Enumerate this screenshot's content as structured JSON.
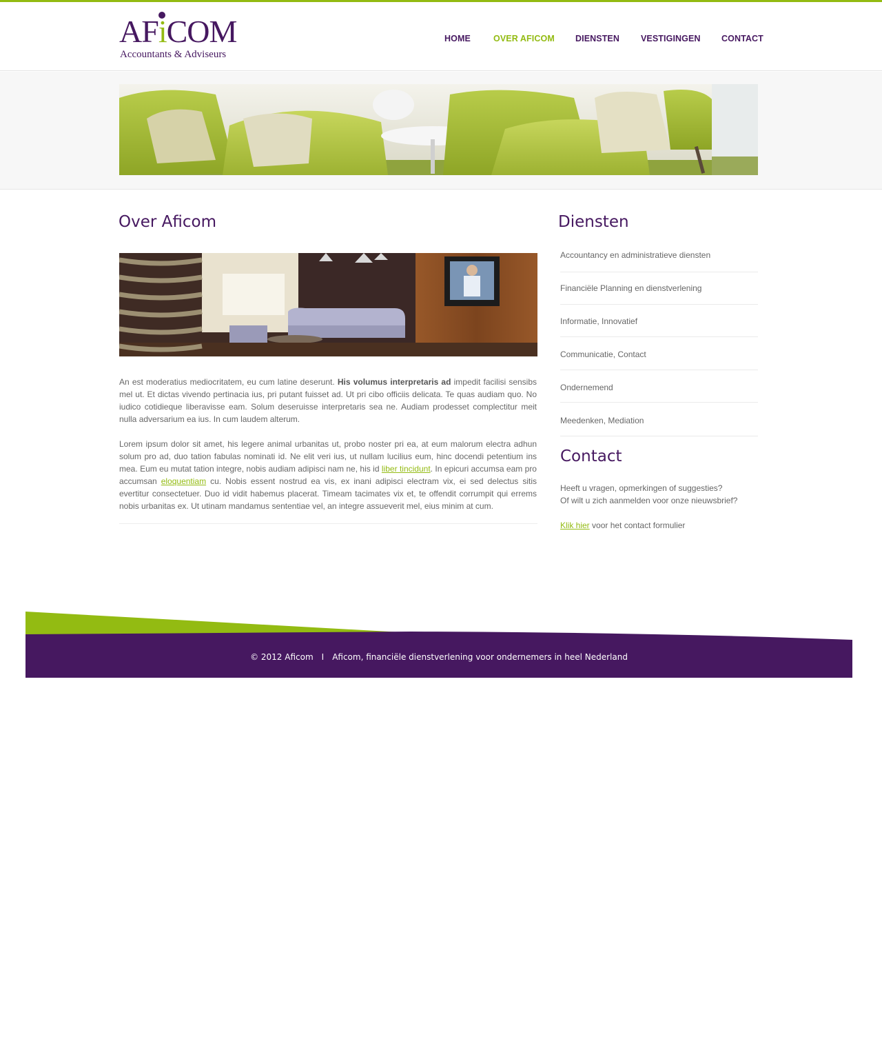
{
  "brand": {
    "logo_word_a": "AF",
    "logo_word_i": "i",
    "logo_word_b": "COM",
    "logo_sub": "Accountants & Adviseurs",
    "purple": "#461860",
    "green": "#93bb12"
  },
  "nav": {
    "items": [
      {
        "label": "HOME"
      },
      {
        "label": "OVER AFICOM"
      },
      {
        "label": "DIENSTEN"
      },
      {
        "label": "VESTIGINGEN"
      },
      {
        "label": "CONTACT"
      }
    ],
    "active_label": "OVER AFICOM"
  },
  "main": {
    "title": "Over Aficom",
    "p1": {
      "start": "An est moderatius mediocritatem, eu cum latine deserunt. ",
      "bold": "His volumus interpretaris ad",
      "end": " impedit facilisi sensibs mel ut. Et dictas vivendo pertinacia ius, pri putant fuisset ad. Ut pri cibo officiis delicata. Te quas audiam quo. No iudico cotidieque liberavisse eam. Solum deseruisse interpretaris sea ne. Audiam prodesset complectitur meit nulla adversarium ea ius. In cum laudem alterum."
    },
    "p2": {
      "a": "Lorem ipsum dolor sit amet, his legere animal urbanitas ut, probo noster pri ea, at eum malorum electra adhun solum pro ad, duo tation fabulas nominati id. Ne elit veri ius, ut nullam lucilius eum, hinc docendi petentium ins mea. Eum eu mutat tation integre, nobis audiam adipisci nam ne, his id ",
      "link1": "liber tincidunt",
      "b": ". In epicuri accumsa eam pro accumsan ",
      "link2": "eloquentiam",
      "c": " cu. Nobis essent nostrud ea vis, ex inani adipisci electram vix, ei sed delectus sitis evertitur consectetuer. Duo id vidit habemus placerat. Timeam tacimates vix et, te offendit corrumpit qui errems nobis urbanitas ex. Ut utinam mandamus sententiae vel, an integre assueverit mel, eius minim at cum."
    }
  },
  "sidebar": {
    "diensten_title": "Diensten",
    "services": [
      {
        "label": "Accountancy en administratieve diensten"
      },
      {
        "label": "Financiële Planning en dienstverlening"
      },
      {
        "label": "Informatie, Innovatief"
      },
      {
        "label": "Communicatie, Contact"
      },
      {
        "label": "Ondernemend"
      },
      {
        "label": "Meedenken, Mediation"
      }
    ],
    "contact_title": "Contact",
    "contact_line1": "Heeft u vragen, opmerkingen of suggesties?",
    "contact_line2": "Of wilt u zich aanmelden voor onze nieuwsbrief?",
    "contact_link": "Klik hier",
    "contact_after": " voor het contact formulier"
  },
  "footer": {
    "copyright": "© 2012 Aficom",
    "separator": "I",
    "tagline": "Aficom, financiële dienstverlening voor ondernemers in heel Nederland"
  }
}
